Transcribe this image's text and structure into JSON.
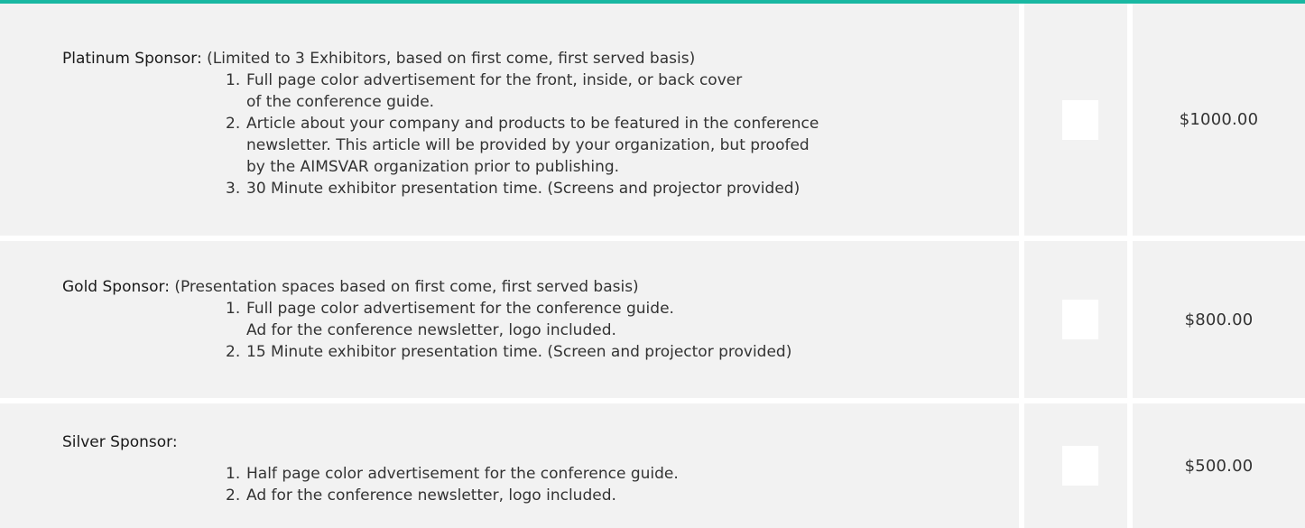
{
  "sponsors": [
    {
      "name": "Platinum Sponsor:",
      "note": " (Limited to 3 Exhibitors, based on first come, first served basis)",
      "items": [
        {
          "num": "1.",
          "text": "Full page color advertisement for the front, inside, or back cover\nof the conference guide."
        },
        {
          "num": "2.",
          "text": "Article about your company and products to be featured in the conference\nnewsletter. This article will be provided by your organization, but proofed\nby the AIMSVAR organization prior to publishing."
        },
        {
          "num": "3.",
          "text": "30 Minute exhibitor presentation time. (Screens and projector provided)"
        }
      ],
      "price": "$1000.00"
    },
    {
      "name": "Gold Sponsor:",
      "note": " (Presentation spaces based on first come, first served basis)",
      "items": [
        {
          "num": "1.",
          "text": "Full page color advertisement for the conference guide.\nAd for the conference newsletter, logo included."
        },
        {
          "num": "2.",
          "text": "15 Minute exhibitor presentation time. (Screen and projector provided)"
        }
      ],
      "price": "$800.00"
    },
    {
      "name": "Silver Sponsor:",
      "note": "",
      "items": [
        {
          "num": "1.",
          "text": "Half page color advertisement for the conference guide."
        },
        {
          "num": "2.",
          "text": "Ad for the conference newsletter, logo included."
        }
      ],
      "price": "$500.00"
    }
  ],
  "colors": {
    "accent_rule": "#19b8a2",
    "cell_background": "#f2f2f2"
  }
}
